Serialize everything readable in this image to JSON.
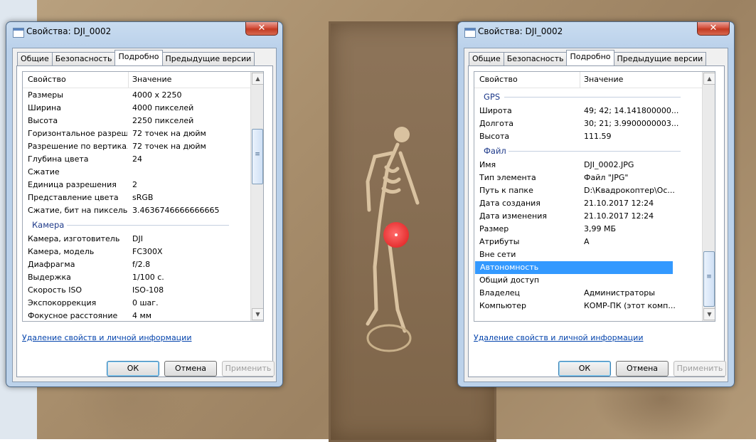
{
  "left_window": {
    "title": "Свойства: DJI_0002",
    "close_glyph": "✕",
    "tabs": [
      "Общие",
      "Безопасность",
      "Подробно",
      "Предыдущие версии"
    ],
    "active_tab": "Подробно",
    "columns": {
      "property": "Свойство",
      "value": "Значение"
    },
    "rows_a": [
      {
        "k": "Размеры",
        "v": "4000 x 2250"
      },
      {
        "k": "Ширина",
        "v": "4000 пикселей"
      },
      {
        "k": "Высота",
        "v": "2250 пикселей"
      },
      {
        "k": "Горизонтальное разреше...",
        "v": "72 точек на дюйм"
      },
      {
        "k": "Разрешение по вертикали",
        "v": "72 точек на дюйм"
      },
      {
        "k": "Глубина цвета",
        "v": "24"
      },
      {
        "k": "Сжатие",
        "v": ""
      },
      {
        "k": "Единица разрешения",
        "v": "2"
      },
      {
        "k": "Представление цвета",
        "v": "sRGB"
      },
      {
        "k": "Сжатие, бит на пиксель",
        "v": "3.4636746666666665"
      }
    ],
    "group_b": "Камера",
    "rows_b": [
      {
        "k": "Камера, изготовитель",
        "v": "DJI"
      },
      {
        "k": "Камера, модель",
        "v": "FC300X"
      },
      {
        "k": "Диафрагма",
        "v": "f/2.8"
      },
      {
        "k": "Выдержка",
        "v": "1/100 с."
      },
      {
        "k": "Скорость ISO",
        "v": "ISO-108"
      },
      {
        "k": "Экспокоррекция",
        "v": "0 шаг."
      },
      {
        "k": "Фокусное расстояние",
        "v": "4 мм"
      }
    ],
    "link": "Удаление свойств и личной информации",
    "buttons": {
      "ok": "ОК",
      "cancel": "Отмена",
      "apply": "Применить"
    }
  },
  "right_window": {
    "title": "Свойства: DJI_0002",
    "close_glyph": "✕",
    "tabs": [
      "Общие",
      "Безопасность",
      "Подробно",
      "Предыдущие версии"
    ],
    "active_tab": "Подробно",
    "columns": {
      "property": "Свойство",
      "value": "Значение"
    },
    "group_a": "GPS",
    "rows_a": [
      {
        "k": "Широта",
        "v": "49; 42; 14.141800000..."
      },
      {
        "k": "Долгота",
        "v": "30; 21; 3.9900000003..."
      },
      {
        "k": "Высота",
        "v": "111.59"
      }
    ],
    "group_b": "Файл",
    "rows_b": [
      {
        "k": "Имя",
        "v": "DJI_0002.JPG"
      },
      {
        "k": "Тип элемента",
        "v": "Файл \"JPG\""
      },
      {
        "k": "Путь к папке",
        "v": "D:\\Квадрокоптер\\Ос..."
      },
      {
        "k": "Дата создания",
        "v": "21.10.2017 12:24"
      },
      {
        "k": "Дата изменения",
        "v": "21.10.2017 12:24"
      },
      {
        "k": "Размер",
        "v": "3,99 МБ"
      },
      {
        "k": "Атрибуты",
        "v": "A"
      },
      {
        "k": "Вне сети",
        "v": ""
      },
      {
        "k": "Автономность",
        "v": "",
        "selected": true
      },
      {
        "k": "Общий доступ",
        "v": ""
      },
      {
        "k": "Владелец",
        "v": "Администраторы"
      },
      {
        "k": "Компьютер",
        "v": "КОМР-ПК (этот комп..."
      }
    ],
    "link": "Удаление свойств и личной информации",
    "buttons": {
      "ok": "ОК",
      "cancel": "Отмена",
      "apply": "Применить"
    }
  },
  "colors": {
    "selection": "#3399ff",
    "link": "#0645ad",
    "group_heading": "#1e3a8a"
  },
  "icons": {
    "scroll_up": "▲",
    "scroll_down": "▼",
    "scroll_grip": "≡"
  }
}
